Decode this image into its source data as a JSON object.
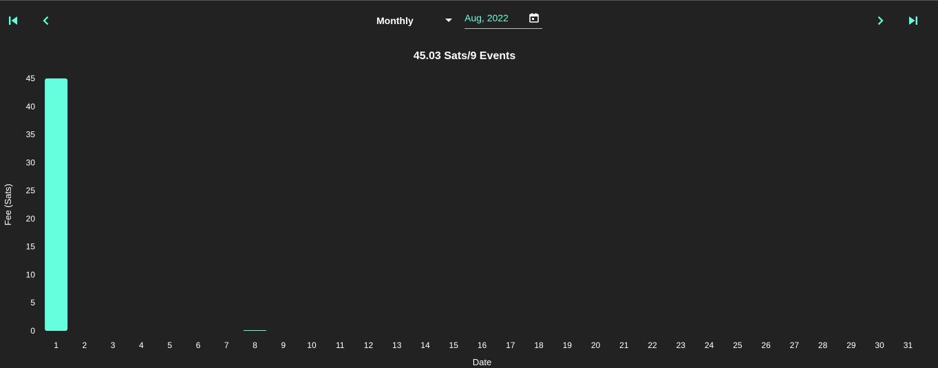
{
  "controls": {
    "first_icon": "skip-previous-icon",
    "prev_icon": "chevron-left-icon",
    "next_icon": "chevron-right-icon",
    "last_icon": "skip-next-icon",
    "range_selected": "Monthly",
    "date_value": "Aug, 2022",
    "calendar_icon": "calendar-icon"
  },
  "colors": {
    "background": "#222222",
    "accent": "#66ffdd",
    "text": "#ffffff"
  },
  "chart_data": {
    "type": "bar",
    "title": "45.03 Sats/9 Events",
    "xlabel": "Date",
    "ylabel": "Fee (Sats)",
    "ylim": [
      0,
      45
    ],
    "yticks": [
      0,
      5,
      10,
      15,
      20,
      25,
      30,
      35,
      40,
      45
    ],
    "categories": [
      "1",
      "2",
      "3",
      "4",
      "5",
      "6",
      "7",
      "8",
      "9",
      "10",
      "11",
      "12",
      "13",
      "14",
      "15",
      "16",
      "17",
      "18",
      "19",
      "20",
      "21",
      "22",
      "23",
      "24",
      "25",
      "26",
      "27",
      "28",
      "29",
      "30",
      "31"
    ],
    "values": [
      45,
      0,
      0,
      0,
      0,
      0,
      0,
      0.03,
      0,
      0,
      0,
      0,
      0,
      0,
      0,
      0,
      0,
      0,
      0,
      0,
      0,
      0,
      0,
      0,
      0,
      0,
      0,
      0,
      0,
      0,
      0
    ],
    "grid": false,
    "legend": "none"
  }
}
